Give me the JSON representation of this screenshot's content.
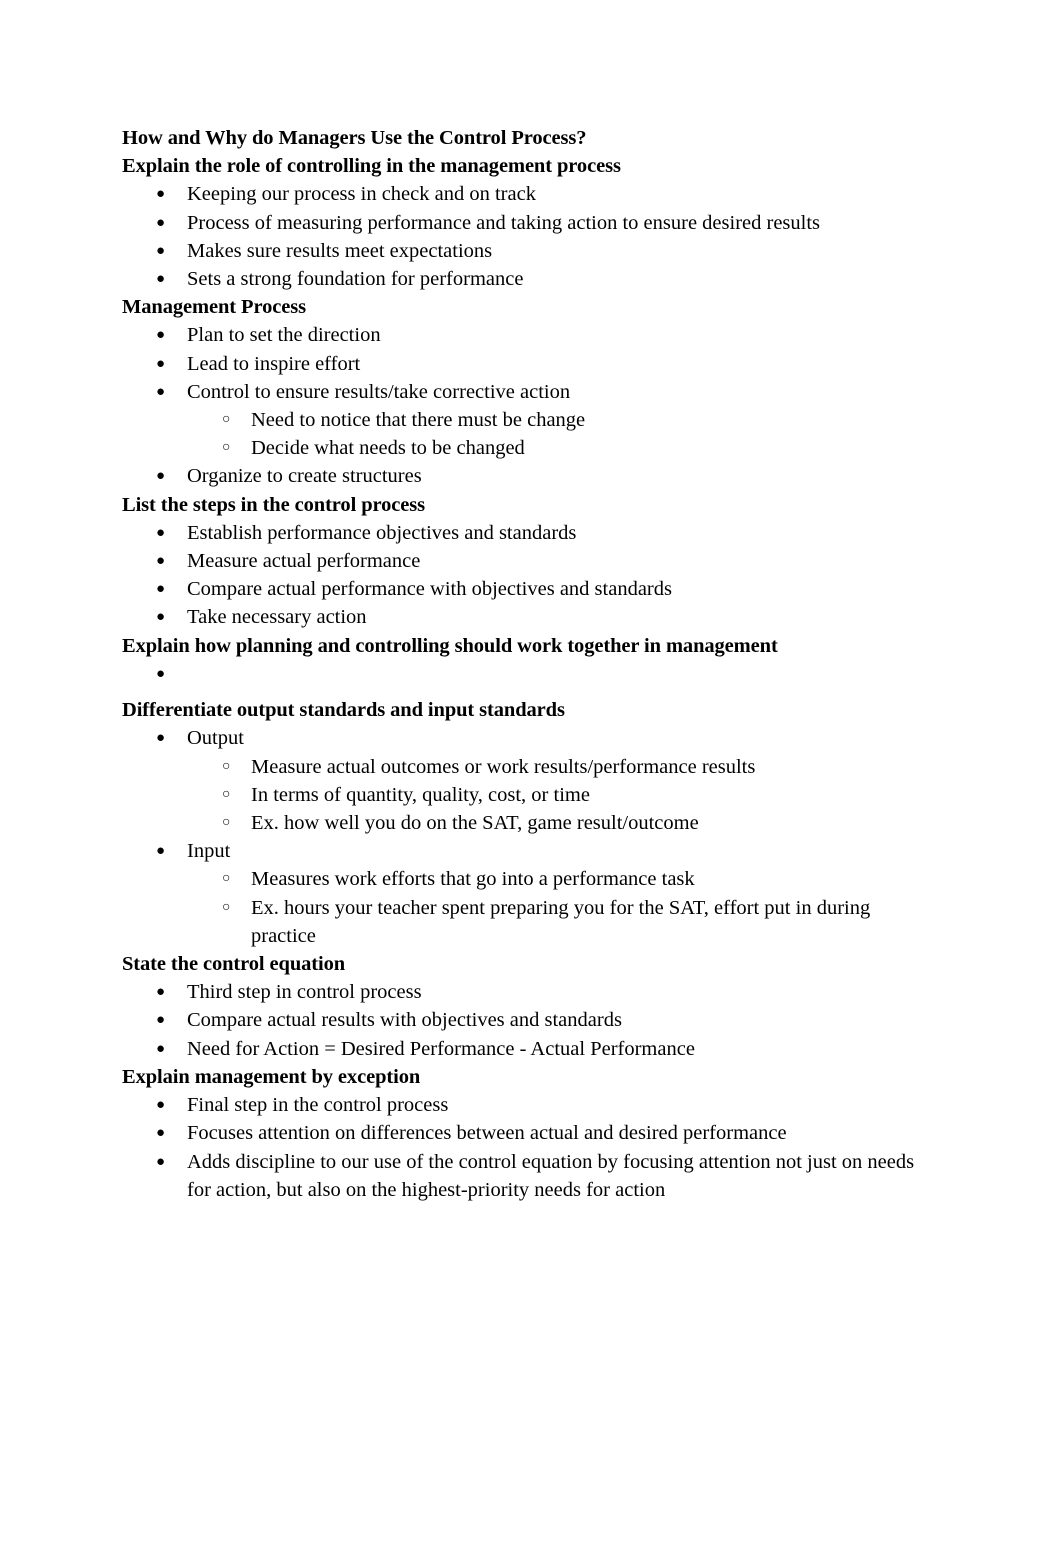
{
  "document": {
    "title": "How and Why do Managers Use the Control Process?",
    "text_color": "#000000",
    "background_color": "#ffffff",
    "markers": {
      "level1": "●",
      "level2": "○"
    },
    "sections": [
      {
        "heading": "Explain the role of controlling in the management process",
        "items": [
          {
            "level": 1,
            "text": "Keeping our process in check and on track"
          },
          {
            "level": 1,
            "text": "Process of measuring performance and taking action to ensure desired results"
          },
          {
            "level": 1,
            "text": "Makes sure results meet expectations"
          },
          {
            "level": 1,
            "text": "Sets a strong foundation for performance"
          }
        ]
      },
      {
        "heading": "Management Process",
        "items": [
          {
            "level": 1,
            "text": "Plan to set the direction"
          },
          {
            "level": 1,
            "text": "Lead to inspire effort"
          },
          {
            "level": 1,
            "text": "Control to ensure results/take corrective action"
          },
          {
            "level": 2,
            "text": "Need to notice that there must be change"
          },
          {
            "level": 2,
            "text": "Decide what needs to be changed"
          },
          {
            "level": 1,
            "text": "Organize to create structures"
          }
        ]
      },
      {
        "heading": "List the steps in the control process",
        "items": [
          {
            "level": 1,
            "text": "Establish performance objectives and standards"
          },
          {
            "level": 1,
            "text": "Measure actual performance"
          },
          {
            "level": 1,
            "text": "Compare actual performance with objectives and standards"
          },
          {
            "level": 1,
            "text": "Take necessary action"
          }
        ]
      },
      {
        "heading": "Explain how planning and controlling should work together in management",
        "items": [
          {
            "level": 1,
            "text": ""
          }
        ]
      },
      {
        "heading": "Differentiate output standards and input standards",
        "items": [
          {
            "level": 1,
            "text": "Output"
          },
          {
            "level": 2,
            "text": "Measure actual outcomes or work results/performance results"
          },
          {
            "level": 2,
            "text": "In terms of quantity, quality, cost, or time"
          },
          {
            "level": 2,
            "text": "Ex. how well you do on the SAT, game result/outcome"
          },
          {
            "level": 1,
            "text": "Input"
          },
          {
            "level": 2,
            "text": "Measures work efforts that go into a performance task"
          },
          {
            "level": 2,
            "text": "Ex. hours your teacher spent preparing you for the SAT, effort put in during practice"
          }
        ]
      },
      {
        "heading": "State the control equation",
        "items": [
          {
            "level": 1,
            "text": "Third step in control process"
          },
          {
            "level": 1,
            "text": "Compare actual results with objectives and standards"
          },
          {
            "level": 1,
            "text": "Need for Action = Desired Performance - Actual Performance"
          }
        ]
      },
      {
        "heading": "Explain management by exception",
        "items": [
          {
            "level": 1,
            "text": "Final step in the control process"
          },
          {
            "level": 1,
            "text": "Focuses attention on differences between actual and desired performance"
          },
          {
            "level": 1,
            "text": "Adds discipline to our use of the control equation by focusing attention not just on needs for action, but also on the highest-priority needs for action"
          }
        ]
      }
    ]
  }
}
